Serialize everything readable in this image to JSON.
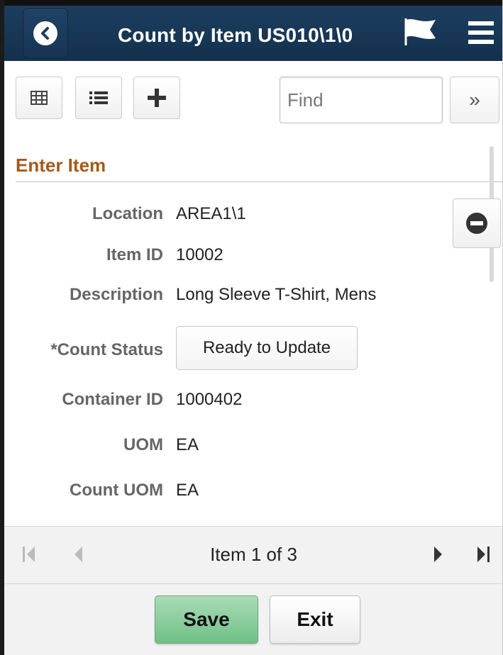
{
  "header": {
    "title": "Count by Item US010\\1\\0",
    "back_icon": "chevron-left-icon",
    "flag_icon": "flag-icon",
    "menu_icon": "hamburger-menu-icon"
  },
  "toolbar": {
    "grid_view_icon": "grid-view-icon",
    "list_view_icon": "list-view-icon",
    "add_icon": "plus-icon",
    "find_placeholder": "Find",
    "more_label": "»"
  },
  "section": {
    "title": "Enter Item"
  },
  "fields": {
    "location_label": "Location",
    "location_value": "AREA1\\1",
    "item_id_label": "Item ID",
    "item_id_value": "10002",
    "description_label": "Description",
    "description_value": "Long Sleeve T-Shirt, Mens",
    "count_status_label": "*Count Status",
    "count_status_value": "Ready to Update",
    "container_id_label": "Container ID",
    "container_id_value": "1000402",
    "uom_label": "UOM",
    "uom_value": "EA",
    "count_uom_label": "Count UOM",
    "count_uom_value": "EA"
  },
  "pager": {
    "text": "Item 1 of 3"
  },
  "footer": {
    "save_label": "Save",
    "exit_label": "Exit"
  },
  "colors": {
    "header_bg": "#173553",
    "section_title": "#a35a1a",
    "save_green": "#6fc087"
  }
}
